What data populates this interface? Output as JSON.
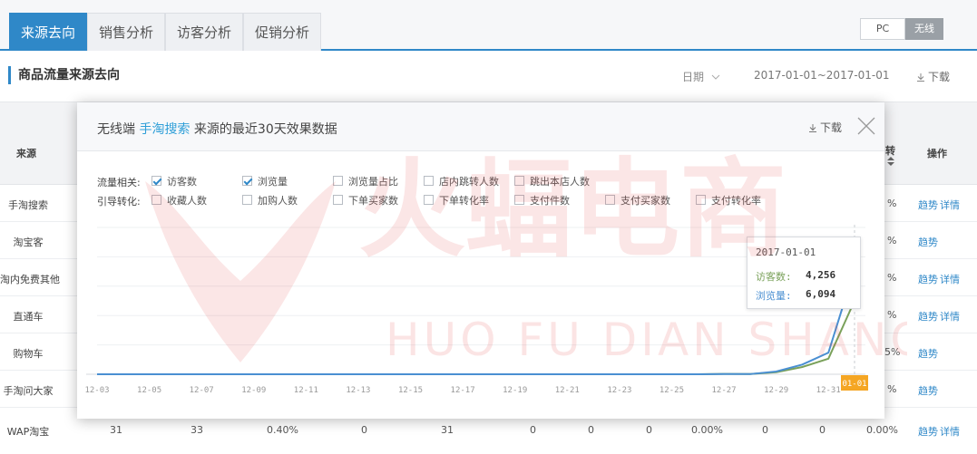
{
  "tabs": [
    {
      "label": "来源去向",
      "active": true
    },
    {
      "label": "销售分析",
      "active": false
    },
    {
      "label": "访客分析",
      "active": false
    },
    {
      "label": "促销分析",
      "active": false
    }
  ],
  "device_switch": {
    "pc": "PC",
    "wireless": "无线",
    "active": "无线"
  },
  "section": {
    "title": "商品流量来源去向",
    "date_label": "日期",
    "date_range": "2017-01-01~2017-01-01",
    "download": "下载"
  },
  "table": {
    "header": {
      "source": "来源",
      "operation": "操作",
      "partial": "转"
    },
    "rows": [
      {
        "source": "手淘搜索",
        "tail": "%",
        "actions": [
          "趋势",
          "详情"
        ]
      },
      {
        "source": "淘宝客",
        "tail": "%",
        "actions": [
          "趋势"
        ]
      },
      {
        "source": "淘内免费其他",
        "tail": "%",
        "actions": [
          "趋势",
          "详情"
        ]
      },
      {
        "source": "直通车",
        "tail": "%",
        "actions": [
          "趋势",
          "详情"
        ]
      },
      {
        "source": "购物车",
        "tail": "5%",
        "actions": [
          "趋势"
        ]
      },
      {
        "source": "手淘问大家",
        "tail": "%",
        "actions": [
          "趋势"
        ]
      },
      {
        "source": "WAP淘宝",
        "cells": [
          "31",
          "33",
          "0.40%",
          "0",
          "31",
          "0",
          "0",
          "0",
          "0.00%",
          "0",
          "0",
          "0.00%"
        ],
        "actions": [
          "趋势",
          "详情"
        ]
      }
    ]
  },
  "watermark": {
    "main": "火蝠电商",
    "sub": "HUO FU DIAN SHANG"
  },
  "modal": {
    "title_prefix": "无线端",
    "title_highlight": "手淘搜索",
    "title_suffix": "来源的最近30天效果数据",
    "download": "下载",
    "group_traffic": "流量相关:",
    "group_conversion": "引导转化:",
    "traffic_metrics": [
      {
        "label": "访客数",
        "checked": true
      },
      {
        "label": "浏览量",
        "checked": true
      },
      {
        "label": "浏览量占比",
        "checked": false
      },
      {
        "label": "店内跳转人数",
        "checked": false
      },
      {
        "label": "跳出本店人数",
        "checked": false
      }
    ],
    "conversion_metrics": [
      {
        "label": "收藏人数",
        "checked": false
      },
      {
        "label": "加购人数",
        "checked": false
      },
      {
        "label": "下单买家数",
        "checked": false
      },
      {
        "label": "下单转化率",
        "checked": false
      },
      {
        "label": "支付件数",
        "checked": false
      },
      {
        "label": "支付买家数",
        "checked": false
      },
      {
        "label": "支付转化率",
        "checked": false
      }
    ],
    "tooltip": {
      "date": "2017-01-01",
      "rows": [
        {
          "label": "访客数:",
          "value": "4,256",
          "color": "#7aa15a"
        },
        {
          "label": "浏览量:",
          "value": "6,094",
          "color": "#4a8fd2"
        }
      ]
    }
  },
  "chart_data": {
    "type": "line",
    "x": [
      "12-03",
      "12-04",
      "12-05",
      "12-06",
      "12-07",
      "12-08",
      "12-09",
      "12-10",
      "12-11",
      "12-12",
      "12-13",
      "12-14",
      "12-15",
      "12-16",
      "12-17",
      "12-18",
      "12-19",
      "12-20",
      "12-21",
      "12-22",
      "12-23",
      "12-24",
      "12-25",
      "12-26",
      "12-27",
      "12-28",
      "12-29",
      "12-30",
      "12-31",
      "01-01"
    ],
    "x_tick_labels": [
      "12-03",
      "12-05",
      "12-07",
      "12-09",
      "12-11",
      "12-13",
      "12-15",
      "12-17",
      "12-19",
      "12-21",
      "12-23",
      "12-25",
      "12-27",
      "12-29",
      "12-31",
      "01-01"
    ],
    "highlight_x": "01-01",
    "series": [
      {
        "name": "访客数",
        "color": "#7aa15a",
        "values": [
          0,
          0,
          0,
          0,
          0,
          0,
          0,
          0,
          0,
          0,
          0,
          0,
          0,
          0,
          0,
          0,
          0,
          0,
          0,
          0,
          0,
          0,
          0,
          0,
          20,
          10,
          120,
          420,
          900,
          4256
        ]
      },
      {
        "name": "浏览量",
        "color": "#4a8fd2",
        "values": [
          0,
          0,
          0,
          0,
          0,
          0,
          0,
          0,
          0,
          0,
          0,
          0,
          0,
          0,
          0,
          0,
          0,
          0,
          0,
          0,
          0,
          0,
          0,
          0,
          15,
          10,
          160,
          560,
          1250,
          6094
        ]
      }
    ],
    "ylim": [
      0,
      8500
    ],
    "grid": true
  },
  "colors": {
    "accent": "#2f88c8",
    "highlight_title": "#2f9fd8",
    "x_highlight_bg": "#f5a623",
    "watermark": "#e23a3a"
  }
}
